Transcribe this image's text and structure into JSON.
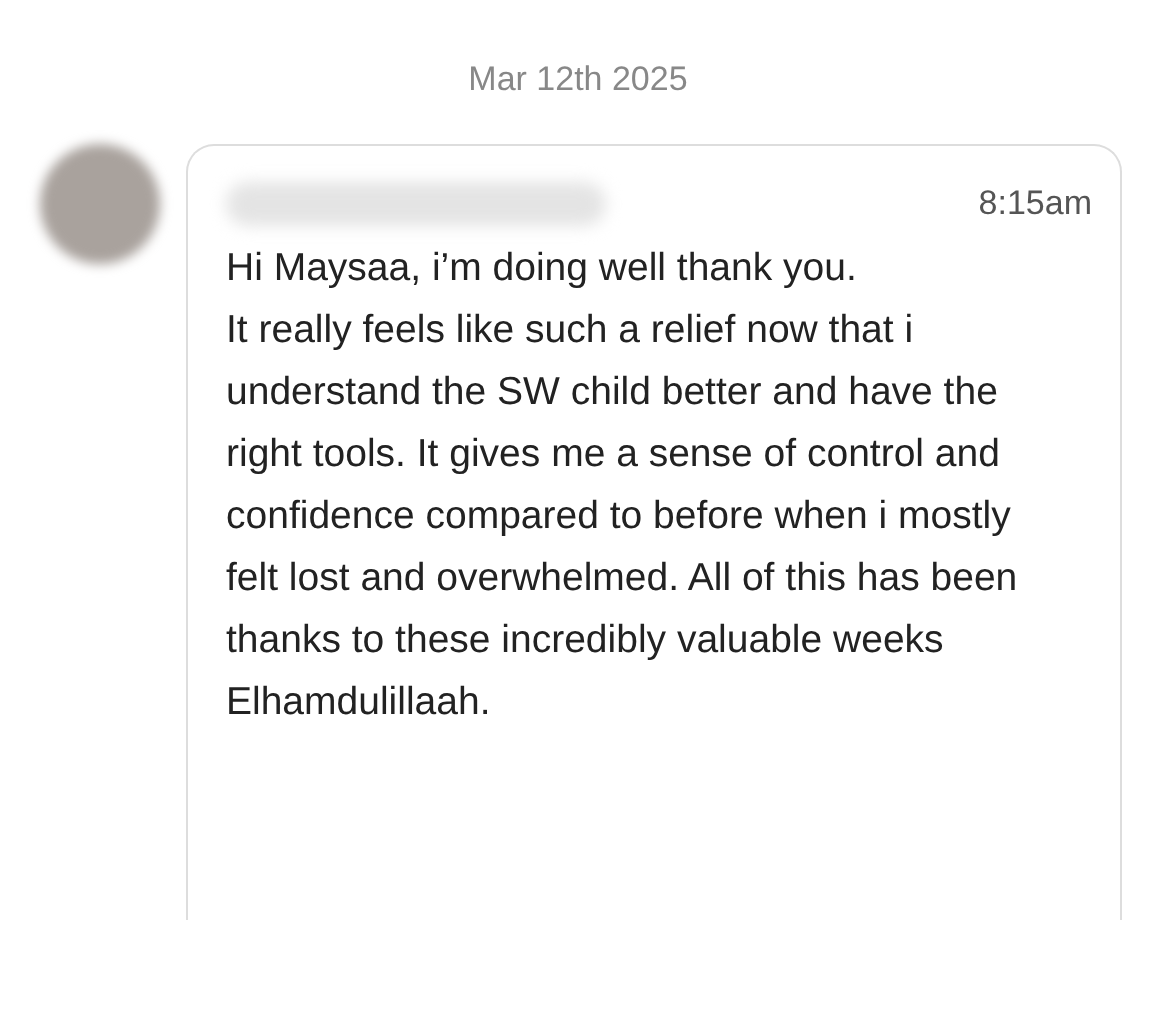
{
  "date_divider": "Mar 12th 2025",
  "message": {
    "time": "8:15am",
    "paragraphs": [
      "Hi Maysaa, i’m doing well thank you.",
      "It really feels like such a relief now that i understand the SW child better and have the right tools. It gives me a sense of control and confidence compared to before when i mostly felt lost and overwhelmed. All of this has been thanks to these incredibly valuable weeks Elhamdulillaah."
    ]
  }
}
